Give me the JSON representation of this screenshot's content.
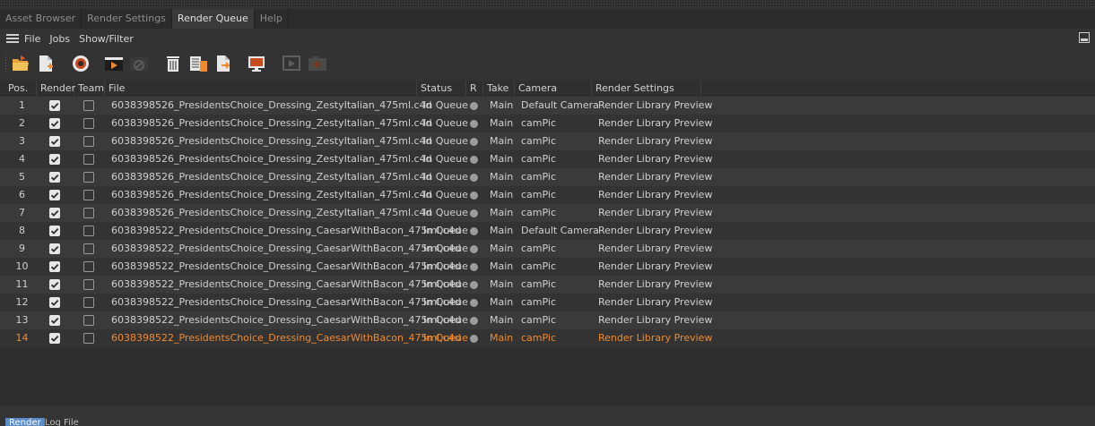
{
  "tabs": [
    {
      "label": "Asset Browser"
    },
    {
      "label": "Render Settings"
    },
    {
      "label": "Render Queue"
    },
    {
      "label": "Help"
    }
  ],
  "menu": {
    "file": "File",
    "jobs": "Jobs",
    "show_filter": "Show/Filter"
  },
  "toolbar_icons": [
    "open-file-icon",
    "add-file-icon",
    "render-check-icon",
    "start-render-icon",
    "stop-render-icon",
    "delete-icon",
    "clear-queue-icon",
    "export-icon",
    "render-view-icon",
    "viewer-icon",
    "camera-icon"
  ],
  "columns": {
    "pos": "Pos.",
    "render": "Render",
    "team": "Team",
    "file": "File",
    "status": "Status",
    "r": "R",
    "take": "Take",
    "camera": "Camera",
    "render_settings": "Render Settings"
  },
  "rows": [
    {
      "pos": "1",
      "file": "6038398526_PresidentsChoice_Dressing_ZestyItalian_475ml.c4d",
      "status": "In Queue",
      "take": "Main",
      "camera": "Default Camera",
      "settings": "Render Library Preview"
    },
    {
      "pos": "2",
      "file": "6038398526_PresidentsChoice_Dressing_ZestyItalian_475ml.c4d",
      "status": "In Queue",
      "take": "Main",
      "camera": "camPic",
      "settings": "Render Library Preview"
    },
    {
      "pos": "3",
      "file": "6038398526_PresidentsChoice_Dressing_ZestyItalian_475ml.c4d",
      "status": "In Queue",
      "take": "Main",
      "camera": "camPic",
      "settings": "Render Library Preview"
    },
    {
      "pos": "4",
      "file": "6038398526_PresidentsChoice_Dressing_ZestyItalian_475ml.c4d",
      "status": "In Queue",
      "take": "Main",
      "camera": "camPic",
      "settings": "Render Library Preview"
    },
    {
      "pos": "5",
      "file": "6038398526_PresidentsChoice_Dressing_ZestyItalian_475ml.c4d",
      "status": "In Queue",
      "take": "Main",
      "camera": "camPic",
      "settings": "Render Library Preview"
    },
    {
      "pos": "6",
      "file": "6038398526_PresidentsChoice_Dressing_ZestyItalian_475ml.c4d",
      "status": "In Queue",
      "take": "Main",
      "camera": "camPic",
      "settings": "Render Library Preview"
    },
    {
      "pos": "7",
      "file": "6038398526_PresidentsChoice_Dressing_ZestyItalian_475ml.c4d",
      "status": "In Queue",
      "take": "Main",
      "camera": "camPic",
      "settings": "Render Library Preview"
    },
    {
      "pos": "8",
      "file": "6038398522_PresidentsChoice_Dressing_CaesarWithBacon_475ml.c4d",
      "status": "In Queue",
      "take": "Main",
      "camera": "Default Camera",
      "settings": "Render Library Preview"
    },
    {
      "pos": "9",
      "file": "6038398522_PresidentsChoice_Dressing_CaesarWithBacon_475ml.c4d",
      "status": "In Queue",
      "take": "Main",
      "camera": "camPic",
      "settings": "Render Library Preview"
    },
    {
      "pos": "10",
      "file": "6038398522_PresidentsChoice_Dressing_CaesarWithBacon_475ml.c4d",
      "status": "In Queue",
      "take": "Main",
      "camera": "camPic",
      "settings": "Render Library Preview"
    },
    {
      "pos": "11",
      "file": "6038398522_PresidentsChoice_Dressing_CaesarWithBacon_475ml.c4d",
      "status": "In Queue",
      "take": "Main",
      "camera": "camPic",
      "settings": "Render Library Preview"
    },
    {
      "pos": "12",
      "file": "6038398522_PresidentsChoice_Dressing_CaesarWithBacon_475ml.c4d",
      "status": "In Queue",
      "take": "Main",
      "camera": "camPic",
      "settings": "Render Library Preview"
    },
    {
      "pos": "13",
      "file": "6038398522_PresidentsChoice_Dressing_CaesarWithBacon_475ml.c4d",
      "status": "In Queue",
      "take": "Main",
      "camera": "camPic",
      "settings": "Render Library Preview"
    },
    {
      "pos": "14",
      "file": "6038398522_PresidentsChoice_Dressing_CaesarWithBacon_475ml.c4d",
      "status": "In Queue",
      "take": "Main",
      "camera": "camPic",
      "settings": "Render Library Preview"
    }
  ],
  "selected_row": "14",
  "colors": {
    "accent": "#f08a2d",
    "active_tab_blue": "#5a8cc8"
  },
  "bottom_tabs": [
    {
      "label": "Render"
    },
    {
      "label": "Log File"
    }
  ]
}
